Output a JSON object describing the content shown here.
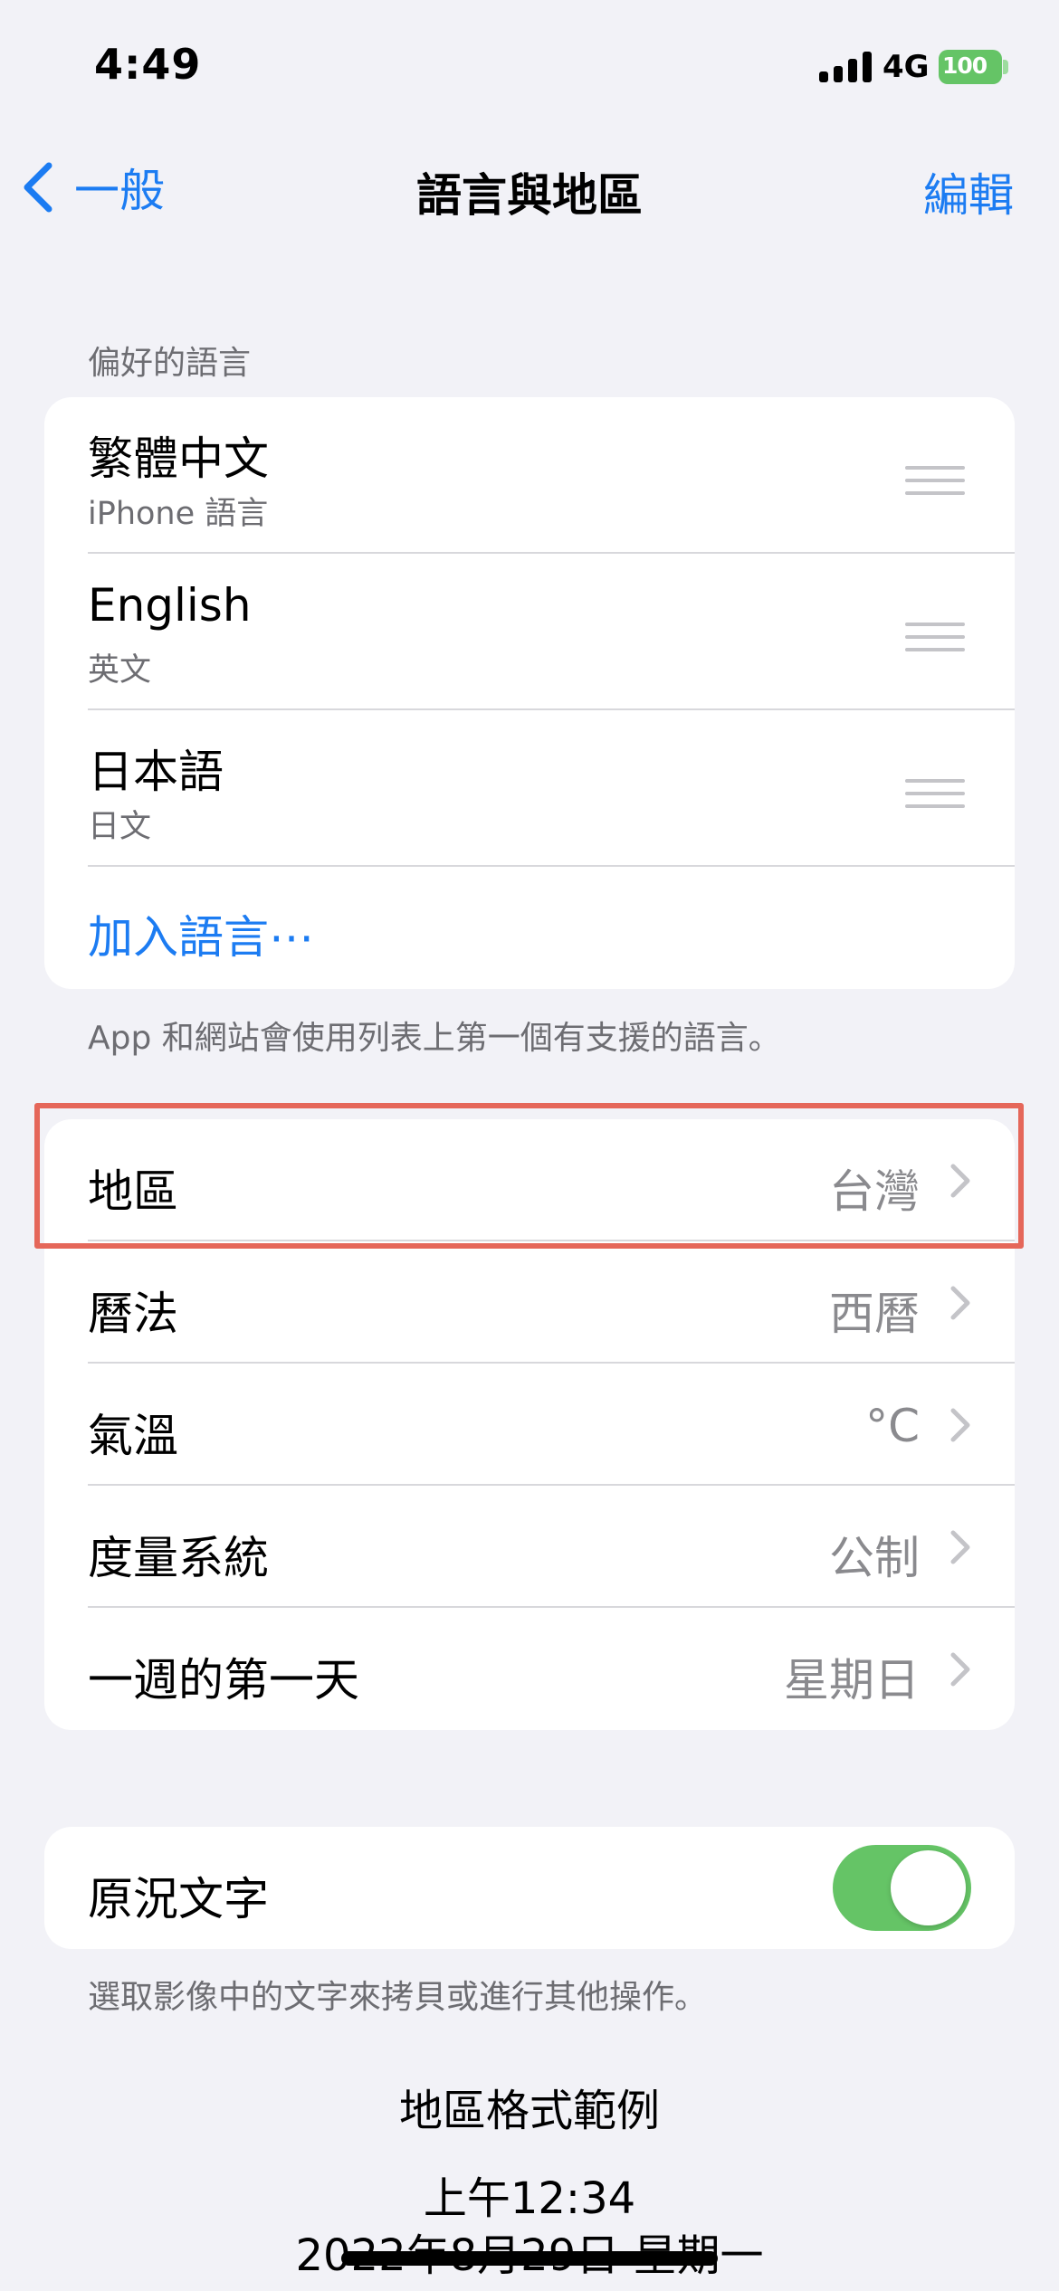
{
  "status_bar": {
    "time": "4:49",
    "network": "4G",
    "battery": "100"
  },
  "nav": {
    "back_label": "一般",
    "title": "語言與地區",
    "edit_label": "編輯"
  },
  "preferred_languages": {
    "header": "偏好的語言",
    "items": [
      {
        "name": "繁體中文",
        "subtitle": "iPhone 語言"
      },
      {
        "name": "English",
        "subtitle": "英文"
      },
      {
        "name": "日本語",
        "subtitle": "日文"
      }
    ],
    "add_label": "加入語言⋯",
    "footer": "App 和網站會使用列表上第一個有支援的語言。"
  },
  "settings": [
    {
      "label": "地區",
      "value": "台灣"
    },
    {
      "label": "曆法",
      "value": "西曆"
    },
    {
      "label": "氣溫",
      "value": "°C"
    },
    {
      "label": "度量系統",
      "value": "公制"
    },
    {
      "label": "一週的第一天",
      "value": "星期日"
    }
  ],
  "live_text": {
    "label": "原況文字",
    "enabled": true,
    "footer": "選取影像中的文字來拷貝或進行其他操作。"
  },
  "region_example": {
    "title": "地區格式範例",
    "time": "上午12:34",
    "date": "2022年8月29日 星期一"
  },
  "colors": {
    "accent": "#1c7cf2",
    "toggle_on": "#65c466",
    "highlight": "#e5675a"
  }
}
